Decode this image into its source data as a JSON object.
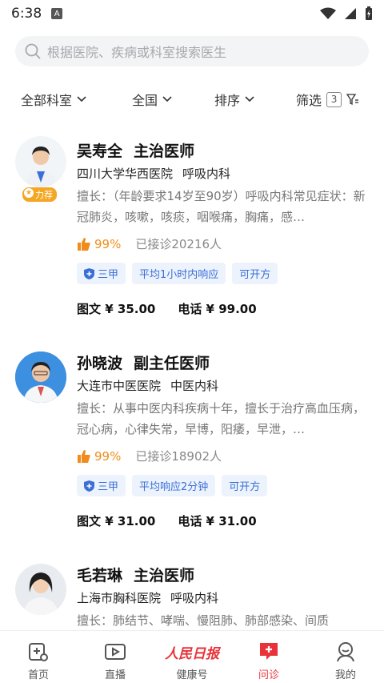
{
  "status": {
    "time": "6:38",
    "notif": "A"
  },
  "search": {
    "placeholder": "根据医院、疾病或科室搜索医生"
  },
  "filters": {
    "dept": "全部科室",
    "region": "全国",
    "sort": "排序",
    "screen": "筛选",
    "screen_count": "3"
  },
  "doctors": [
    {
      "name": "吴寿全",
      "title": "主治医师",
      "hospital": "四川大学华西医院",
      "dept": "呼吸内科",
      "specialty": "擅长：（年龄要求14岁至90岁）呼吸内科常见症状：新冠肺炎，咳嗽，咳痰，咽喉痛，胸痛，感…",
      "rating": "99%",
      "visits": "已接诊20216人",
      "badge": "力荐",
      "tags": [
        "三甲",
        "平均1小时内响应",
        "可开方"
      ],
      "text_price": "图文 ¥ 35.00",
      "phone_price": "电话 ¥ 99.00"
    },
    {
      "name": "孙晓波",
      "title": "副主任医师",
      "hospital": "大连市中医医院",
      "dept": "中医内科",
      "specialty": "擅长：从事中医内科疾病十年，擅长于治疗高血压病，冠心病，心律失常，早博，阳痿，早泄，…",
      "rating": "99%",
      "visits": "已接诊18902人",
      "tags": [
        "三甲",
        "平均响应2分钟",
        "可开方"
      ],
      "text_price": "图文 ¥ 31.00",
      "phone_price": "电话 ¥ 31.00"
    },
    {
      "name": "毛若琳",
      "title": "主治医师",
      "hospital": "上海市胸科医院",
      "dept": "呼吸内科",
      "specialty": "擅长：肺结节、哮喘、慢阻肺、肺部感染、间质"
    }
  ],
  "nav": [
    {
      "label": "首页",
      "icon": "home-icon"
    },
    {
      "label": "直播",
      "icon": "live-icon"
    },
    {
      "label": "健康号",
      "icon": "peoples-daily-logo",
      "logo_text": "人民日报"
    },
    {
      "label": "问诊",
      "icon": "consult-icon"
    },
    {
      "label": "我的",
      "icon": "profile-icon"
    }
  ],
  "colors": {
    "accent": "#e8333a",
    "tag_text": "#3b6fd6",
    "tag_bg": "#edf3fd",
    "rating": "#f08c1a",
    "badge": "#f5a623"
  }
}
